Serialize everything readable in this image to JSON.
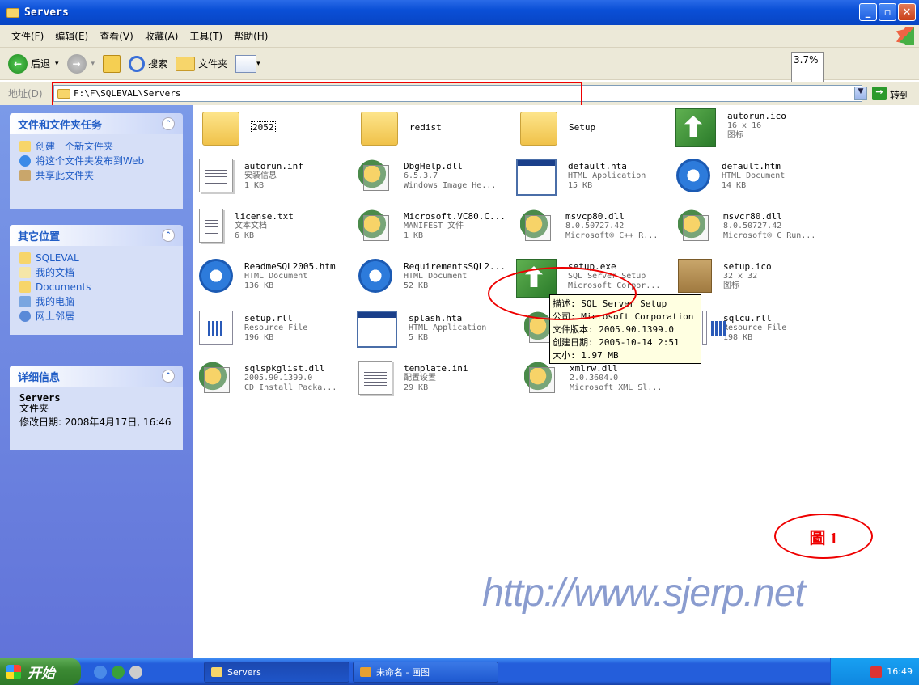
{
  "window": {
    "title": "Servers"
  },
  "menu": [
    "文件(F)",
    "编辑(E)",
    "查看(V)",
    "收藏(A)",
    "工具(T)",
    "帮助(H)"
  ],
  "toolbar": {
    "back": "后退",
    "search": "搜索",
    "folders": "文件夹",
    "zoom": "3.7%"
  },
  "address": {
    "label": "地址(D)",
    "path": "F:\\F\\SQLEVAL\\Servers",
    "go": "转到"
  },
  "tasks": {
    "title": "文件和文件夹任务",
    "items": [
      "创建一个新文件夹",
      "将这个文件夹发布到Web",
      "共享此文件夹"
    ]
  },
  "places": {
    "title": "其它位置",
    "items": [
      "SQLEVAL",
      "我的文档",
      "Documents",
      "我的电脑",
      "网上邻居"
    ]
  },
  "details": {
    "title": "详细信息",
    "name": "Servers",
    "type": "文件夹",
    "modified": "修改日期: 2008年4月17日, 16:46"
  },
  "files": [
    {
      "name": "2052",
      "l2": "",
      "l3": "",
      "icon": "folder"
    },
    {
      "name": "redist",
      "l2": "",
      "l3": "",
      "icon": "folder"
    },
    {
      "name": "Setup",
      "l2": "",
      "l3": "",
      "icon": "folder"
    },
    {
      "name": "autorun.ico",
      "l2": "16 x 16",
      "l3": "图标",
      "icon": "setup"
    },
    {
      "name": "autorun.inf",
      "l2": "安装信息",
      "l3": "1 KB",
      "icon": "doc"
    },
    {
      "name": "DbgHelp.dll",
      "l2": "6.5.3.7",
      "l3": "Windows Image He...",
      "icon": "gear"
    },
    {
      "name": "default.hta",
      "l2": "HTML Application",
      "l3": "15 KB",
      "icon": "app"
    },
    {
      "name": "default.htm",
      "l2": "HTML Document",
      "l3": "14 KB",
      "icon": "ie"
    },
    {
      "name": "license.txt",
      "l2": "文本文档",
      "l3": "6 KB",
      "icon": "doc"
    },
    {
      "name": "Microsoft.VC80.C...",
      "l2": "MANIFEST 文件",
      "l3": "1 KB",
      "icon": "gear"
    },
    {
      "name": "msvcp80.dll",
      "l2": "8.0.50727.42",
      "l3": "Microsoft® C++ R...",
      "icon": "gear"
    },
    {
      "name": "msvcr80.dll",
      "l2": "8.0.50727.42",
      "l3": "Microsoft® C Run...",
      "icon": "gear"
    },
    {
      "name": "ReadmeSQL2005.htm",
      "l2": "HTML Document",
      "l3": "136 KB",
      "icon": "ie"
    },
    {
      "name": "RequirementsSQL2...",
      "l2": "HTML Document",
      "l3": "52 KB",
      "icon": "ie"
    },
    {
      "name": "setup.exe",
      "l2": "SQL Server Setup",
      "l3": "Microsoft Corpor...",
      "icon": "setup"
    },
    {
      "name": "setup.ico",
      "l2": "32 x 32",
      "l3": "图标",
      "icon": "box3d"
    },
    {
      "name": "setup.rll",
      "l2": "Resource File",
      "l3": "196 KB",
      "icon": "rll"
    },
    {
      "name": "splash.hta",
      "l2": "HTML Application",
      "l3": "5 KB",
      "icon": "app"
    },
    {
      "name": "",
      "l2": "",
      "l3": "",
      "icon": "gear"
    },
    {
      "name": "sqlcu.rll",
      "l2": "Resource File",
      "l3": "198 KB",
      "icon": "rll"
    },
    {
      "name": "sqlspkglist.dll",
      "l2": "2005.90.1399.0",
      "l3": "CD Install Packa...",
      "icon": "gear"
    },
    {
      "name": "template.ini",
      "l2": "配置设置",
      "l3": "29 KB",
      "icon": "doc"
    },
    {
      "name": "xmlrw.dll",
      "l2": "2.0.3604.0",
      "l3": "Microsoft XML Sl...",
      "icon": "gear"
    }
  ],
  "tooltip": [
    "描述: SQL Server Setup",
    "公司: Microsoft Corporation",
    "文件版本: 2005.90.1399.0",
    "创建日期: 2005-10-14 2:51",
    "大小: 1.97 MB"
  ],
  "annotation": "圖 1",
  "watermark": "http://www.sjerp.net",
  "taskbar": {
    "start": "开始",
    "btn1": "Servers",
    "btn2": "未命名 - 画图",
    "clock": "16:49"
  }
}
